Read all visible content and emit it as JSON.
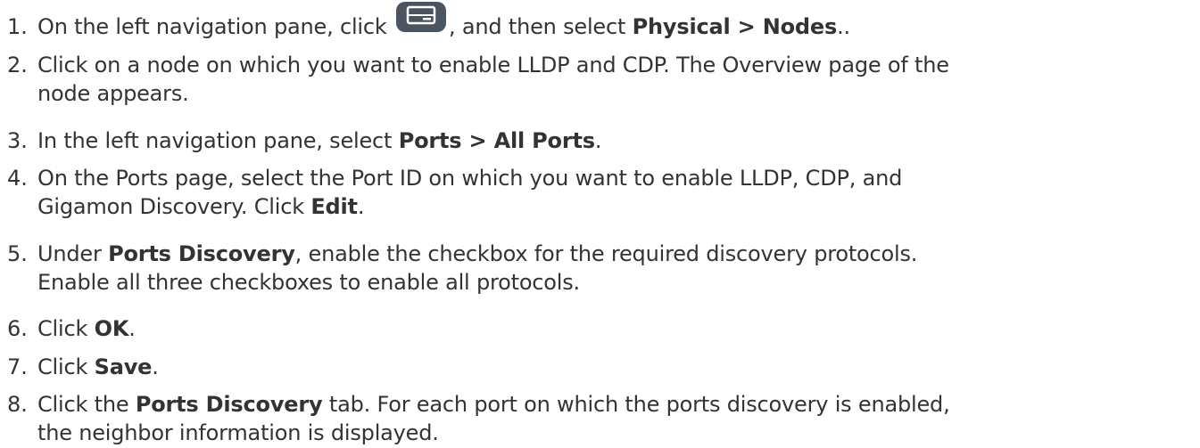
{
  "steps": [
    {
      "number": "1.",
      "pre": "On the left navigation pane, click",
      "icon": "server-icon",
      "mid": ", and then select ",
      "bold": "Physical > Nodes",
      "post": ".."
    },
    {
      "number": "2.",
      "line1": "Click on a node on which you want to enable LLDP and CDP. The Overview page of the",
      "line2": "node appears."
    },
    {
      "number": "3.",
      "pre": "In the left navigation pane, select ",
      "bold": "Ports > All Ports",
      "post": "."
    },
    {
      "number": "4.",
      "line1": "On the Ports page, select the Port ID on which you want to enable LLDP, CDP, and",
      "line2_pre": "Gigamon Discovery. Click ",
      "line2_bold": "Edit",
      "line2_post": "."
    },
    {
      "number": "5.",
      "pre": "Under ",
      "bold": "Ports Discovery",
      "post": ", enable the checkbox for the required discovery protocols.",
      "line2": "Enable all three checkboxes to enable all protocols."
    },
    {
      "number": "6.",
      "pre": "Click ",
      "bold": "OK",
      "post": "."
    },
    {
      "number": "7.",
      "pre": "Click ",
      "bold": "Save",
      "post": "."
    },
    {
      "number": "8.",
      "pre": "Click the ",
      "bold": "Ports Discovery",
      "post": " tab. For each port on which the ports discovery is enabled,",
      "line2": "the neighbor information is displayed."
    }
  ],
  "colors": {
    "text": "#333333",
    "icon_fill": "#4a5560"
  }
}
